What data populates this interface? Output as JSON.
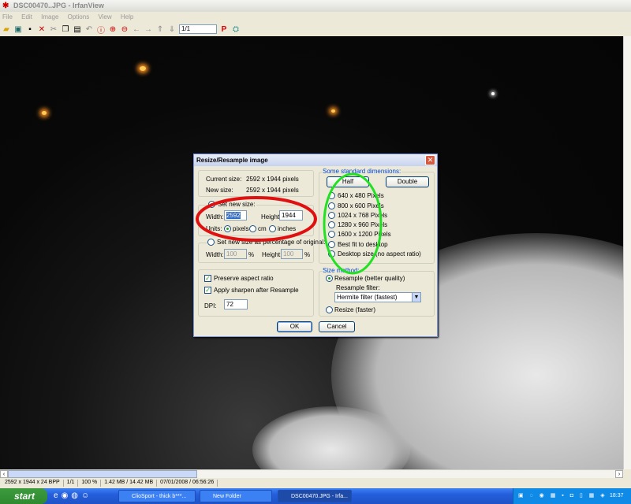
{
  "window": {
    "title": "DSC00470..JPG - IrfanView"
  },
  "menu": [
    "File",
    "Edit",
    "Image",
    "Options",
    "View",
    "Help"
  ],
  "toolbar": {
    "page_value": "1/1"
  },
  "status": [
    "2592 x 1944 x 24 BPP",
    "1/1",
    "100 %",
    "1.42 MB / 14.42 MB",
    "07/01/2008 / 06:56:26"
  ],
  "dialog": {
    "title": "Resize/Resample image",
    "current_label": "Current size:",
    "current_value": "2592  x  1944  pixels",
    "new_label": "New size:",
    "new_value": "2592  x  1944  pixels",
    "set_new_size": "Set new size:",
    "width_label": "Width:",
    "width_value": "2592",
    "height_label": "Height:",
    "height_value": "1944",
    "units_label": "Units:",
    "unit_pixels": "pixels",
    "unit_cm": "cm",
    "unit_inches": "inches",
    "percentage_label": "Set new size as percentage of original:",
    "pct_width_label": "Width:",
    "pct_width_value": "100",
    "pct_symbol": "%",
    "pct_height_label": "Height:",
    "pct_height_value": "100",
    "preserve_label": "Preserve aspect ratio",
    "sharpen_label": "Apply sharpen after Resample",
    "dpi_label": "DPI:",
    "dpi_value": "72",
    "standard_title": "Some standard dimensions:",
    "half_label": "Half",
    "double_label": "Double",
    "standard_options": [
      "640 x 480 Pixels",
      "800 x 600 Pixels",
      "1024 x 768 Pixels",
      "1280 x 960 Pixels",
      "1600 x 1200 Pixels",
      "Best fit to desktop",
      "Desktop size (no aspect ratio)"
    ],
    "method_title": "Size method:",
    "resample_label": "Resample (better quality)",
    "filter_label": "Resample filter:",
    "filter_value": "Hermite filter (fastest)",
    "resize_label": "Resize (faster)",
    "ok_label": "OK",
    "cancel_label": "Cancel"
  },
  "taskbar": {
    "start": "start",
    "tasks": [
      "ClioSport - thick b***...",
      "New Folder",
      "DSC00470.JPG - Irfa..."
    ],
    "clock": "18:37"
  },
  "annotation_colors": {
    "red": "#e01010",
    "green": "#22e022"
  }
}
